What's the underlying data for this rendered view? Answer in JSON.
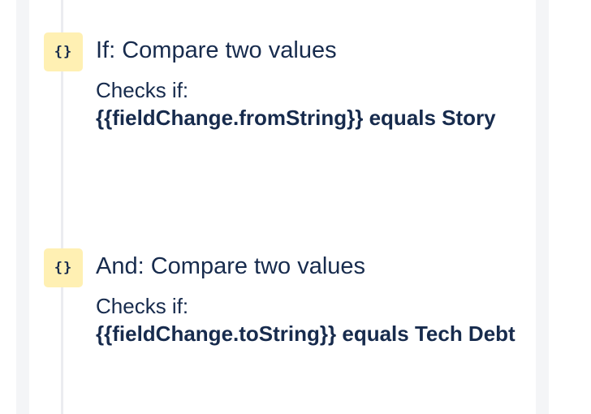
{
  "components": [
    {
      "icon": "{}",
      "icon_name": "curly-braces-icon",
      "title": "If: Compare two values",
      "desc_label": "Checks if:",
      "desc_value": "{{fieldChange.fromString}} equals Story"
    },
    {
      "icon": "{}",
      "icon_name": "curly-braces-icon",
      "title": "And: Compare two values",
      "desc_label": "Checks if:",
      "desc_value": "{{fieldChange.toString}} equals Tech Debt"
    }
  ],
  "colors": {
    "text": "#172b4d",
    "icon_bg": "#fff0b3",
    "panel_bg": "#f4f5f7",
    "timeline": "#ebecf0"
  }
}
